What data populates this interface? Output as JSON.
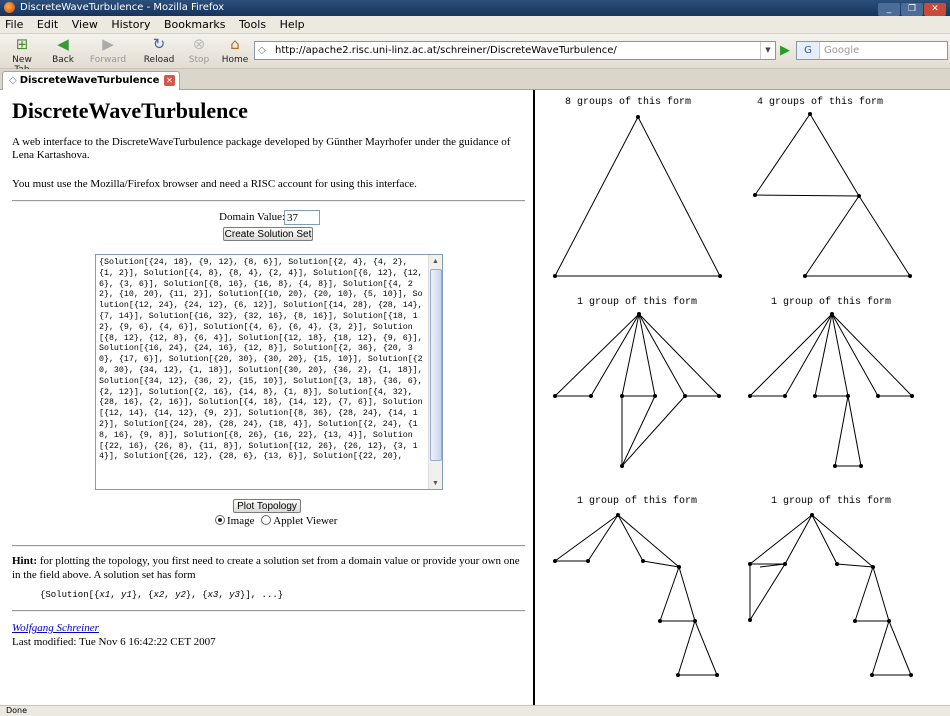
{
  "window": {
    "title": "DiscreteWaveTurbulence - Mozilla Firefox",
    "controls": [
      "_",
      "❐",
      "✕"
    ]
  },
  "menu": [
    "File",
    "Edit",
    "View",
    "History",
    "Bookmarks",
    "Tools",
    "Help"
  ],
  "toolbar": {
    "new_tab": "New Tab",
    "back": "Back",
    "forward": "Forward",
    "reload": "Reload",
    "stop": "Stop",
    "home": "Home",
    "url": "http://apache2.risc.uni-linz.ac.at/schreiner/DiscreteWaveTurbulence/",
    "search_placeholder": "Google",
    "search_engine": "G"
  },
  "tab": {
    "label": "DiscreteWaveTurbulence"
  },
  "page": {
    "heading": "DiscreteWaveTurbulence",
    "intro": "A web interface to the DiscreteWaveTurbulence package developed by Günther Mayrhofer under the guidance of Lena Kartashova.",
    "browser_note": "You must use the Mozilla/Firefox browser and need a RISC account for using this interface.",
    "domain_label": "Domain Value:",
    "domain_value": "37",
    "create_button": "Create Solution Set",
    "solution_text": "{Solution[{24, 18}, {9, 12}, {8, 6}], Solution[{2, 4}, {4, 2}, {1, 2}], Solution[{4, 8}, {8, 4}, {2, 4}], Solution[{6, 12}, {12, 6}, {3, 6}], Solution[{8, 16}, {16, 8}, {4, 8}], Solution[{4, 22}, {10, 20}, {11, 2}], Solution[{10, 20}, {20, 10}, {5, 10}], Solution[{12, 24}, {24, 12}, {6, 12}], Solution[{14, 28}, {28, 14}, {7, 14}], Solution[{16, 32}, {32, 16}, {8, 16}], Solution[{18, 12}, {9, 6}, {4, 6}], Solution[{4, 6}, {6, 4}, {3, 2}], Solution[{8, 12}, {12, 8}, {6, 4}], Solution[{12, 18}, {18, 12}, {9, 6}], Solution[{16, 24}, {24, 16}, {12, 8}], Solution[{2, 36}, {20, 30}, {17, 6}], Solution[{20, 30}, {30, 20}, {15, 10}], Solution[{20, 30}, {34, 12}, {1, 18}], Solution[{30, 20}, {36, 2}, {1, 18}], Solution[{34, 12}, {36, 2}, {15, 10}], Solution[{3, 18}, {36, 6}, {2, 12}], Solution[{2, 16}, {14, 8}, {1, 8}], Solution[{4, 32}, {28, 16}, {2, 16}], Solution[{4, 18}, {14, 12}, {7, 6}], Solution[{12, 14}, {14, 12}, {9, 2}], Solution[{8, 36}, {28, 24}, {14, 12}], Solution[{24, 28}, {28, 24}, {18, 4}], Solution[{2, 24}, {18, 16}, {9, 8}], Solution[{8, 26}, {16, 22}, {13, 4}], Solution[{22, 16}, {26, 8}, {11, 8}], Solution[{12, 26}, {26, 12}, {3, 14}], Solution[{26, 12}, {28, 6}, {13, 6}], Solution[{22, 20},",
    "plot_button": "Plot Topology",
    "radio_image": "Image",
    "radio_applet": "Applet Viewer",
    "hint_label": "Hint:",
    "hint_text": " for plotting the topology, you first need to create a solution set from a domain value or provide your own one in the field above. A solution set has form",
    "form_prefix": "{Solution[{",
    "form_vars": [
      "x1",
      "y1",
      "x2",
      "y2",
      "x3",
      "y3"
    ],
    "form_suffix": "}], ...}",
    "author": "Wolfgang Schreiner",
    "modified": "Last modified: Tue Nov 6 16:42:22 CET 2007"
  },
  "figures": [
    {
      "caption": "8 groups of this form"
    },
    {
      "caption": "4 groups of this form"
    },
    {
      "caption": "1 group of this form"
    },
    {
      "caption": "1 group of this form"
    },
    {
      "caption": "1 group of this form"
    },
    {
      "caption": "1 group of this form"
    }
  ],
  "status": {
    "text": "Done"
  }
}
